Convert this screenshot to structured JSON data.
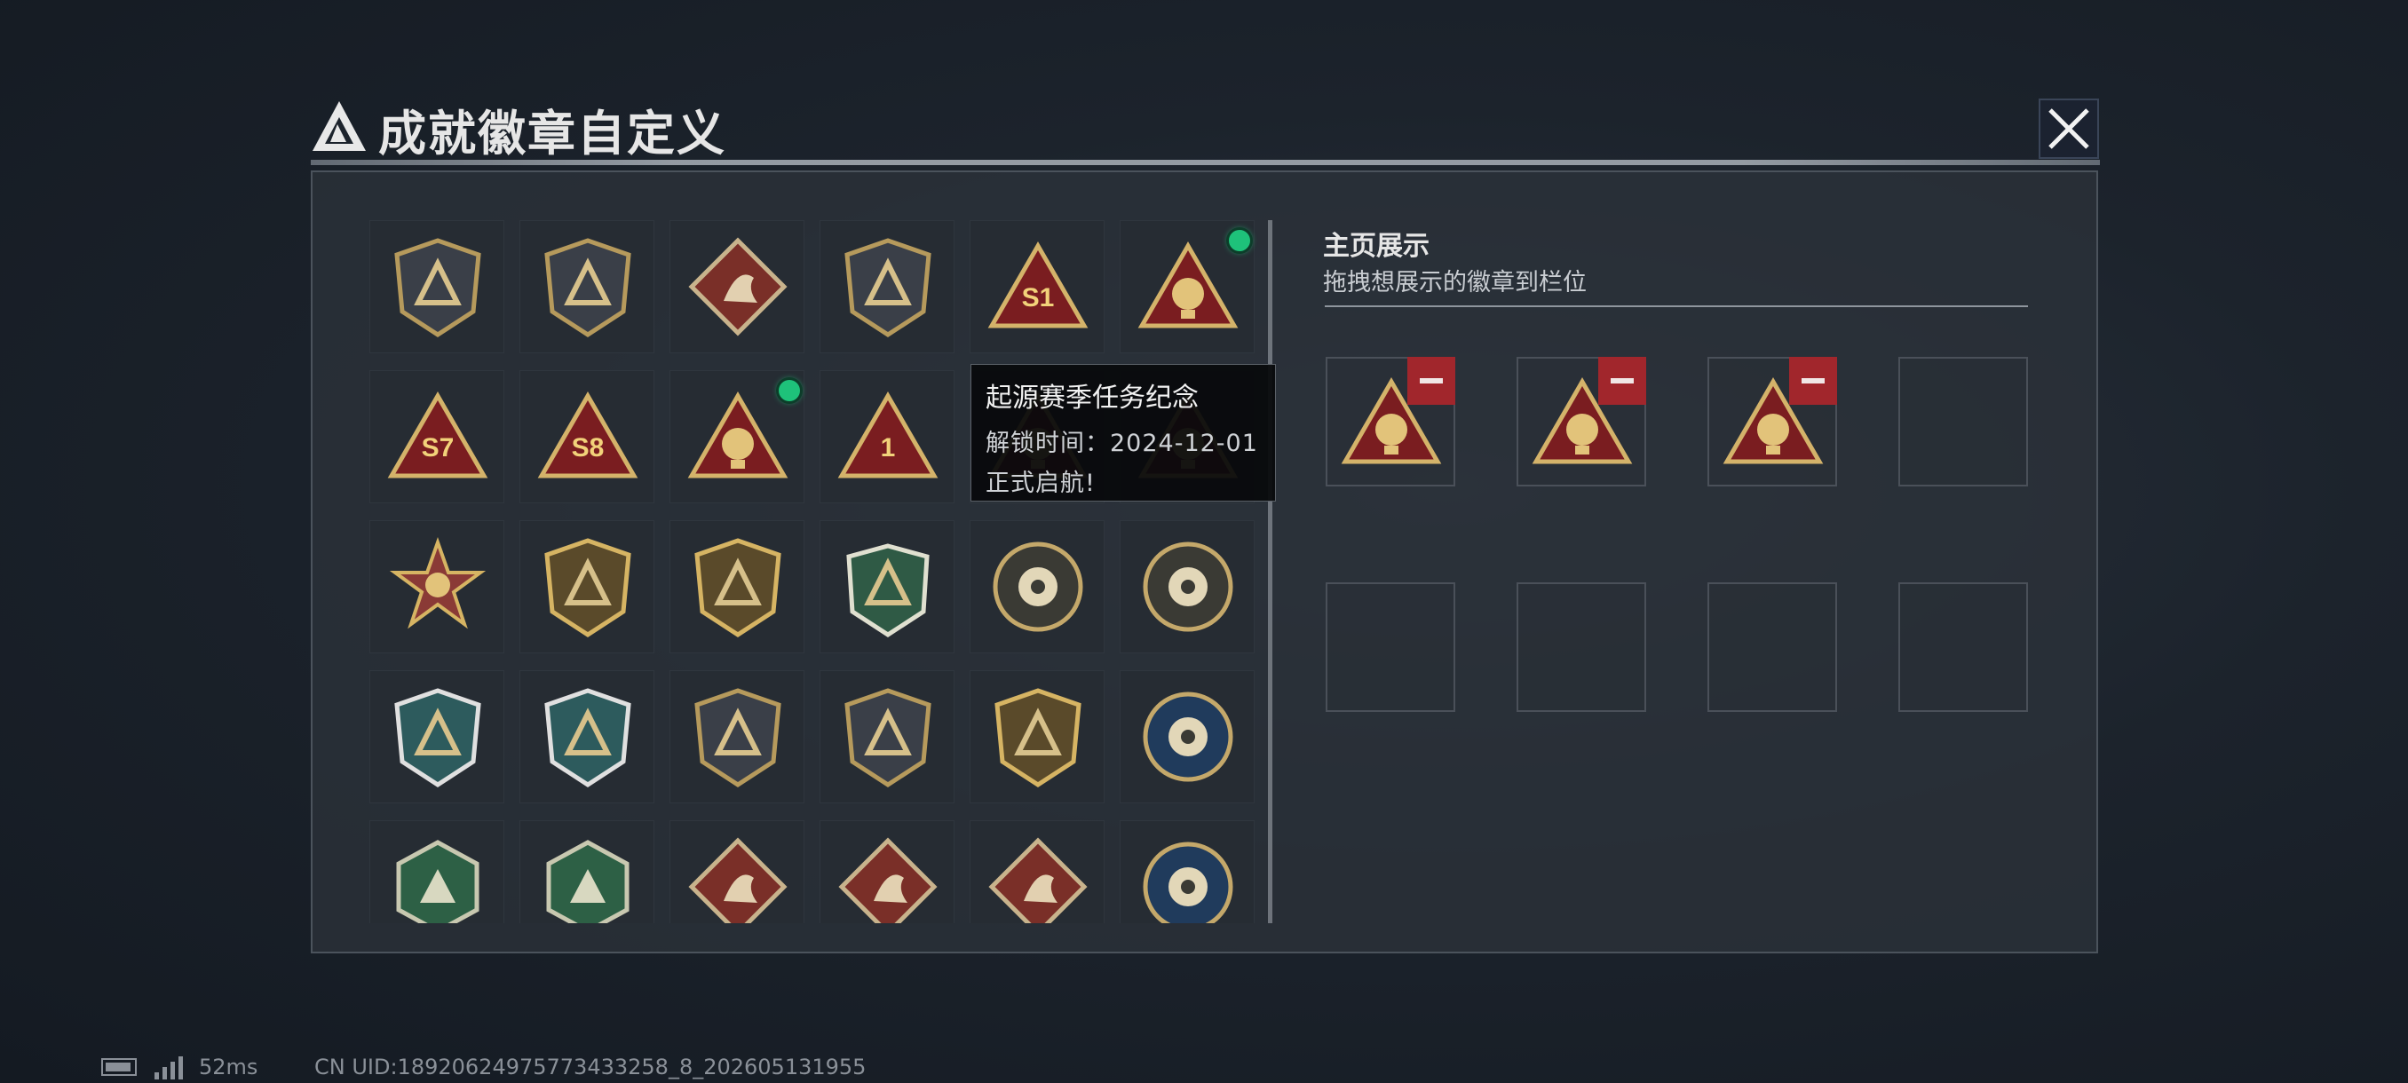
{
  "header": {
    "title": "成就徽章自定义"
  },
  "tooltip": {
    "title": "起源赛季任务纪念",
    "unlock_label": "解锁时间：",
    "unlock_date": "2024-12-01",
    "description": "正式启航!"
  },
  "showcase": {
    "title": "主页展示",
    "subtitle": "拖拽想展示的徽章到栏位"
  },
  "status": {
    "ping": "52ms",
    "uid": "CN UID:18920624975773433258_8_202605131955"
  },
  "badges": [
    {
      "name": "badge-delta-shield-icon",
      "selected": false
    },
    {
      "name": "badge-helicopter-shield-icon",
      "selected": false
    },
    {
      "name": "badge-diamond-shield-icon",
      "selected": false
    },
    {
      "name": "badge-dagger-shield-icon",
      "selected": false
    },
    {
      "name": "badge-s1-triangle-icon",
      "label": "S1",
      "selected": false
    },
    {
      "name": "badge-globe-triangle-icon",
      "selected": true
    },
    {
      "name": "badge-s7-triangle-icon",
      "label": "S7",
      "selected": false
    },
    {
      "name": "badge-s8-triangle-icon",
      "label": "S8",
      "selected": false
    },
    {
      "name": "badge-ship-triangle-icon",
      "selected": true
    },
    {
      "name": "badge-one-triangle-icon",
      "label": "1",
      "selected": false
    },
    {
      "name": "badge-rocket-triangle-icon",
      "selected": false
    },
    {
      "name": "badge-crowned-triangle-icon",
      "selected": false
    },
    {
      "name": "badge-star-medal-icon",
      "selected": false
    },
    {
      "name": "badge-gold-shield-icon",
      "selected": false
    },
    {
      "name": "badge-star-crest-icon",
      "selected": false
    },
    {
      "name": "badge-green-gem-shield-icon",
      "selected": false
    },
    {
      "name": "badge-round-sniper-icon",
      "selected": false
    },
    {
      "name": "badge-round-skull-icon",
      "selected": false
    },
    {
      "name": "badge-rifle-crest-blue-icon",
      "selected": false
    },
    {
      "name": "badge-rifle-crest-blue-2-icon",
      "selected": false
    },
    {
      "name": "badge-knife-shield-icon",
      "selected": false
    },
    {
      "name": "badge-pistol-shield-icon",
      "selected": false
    },
    {
      "name": "badge-gold-rifle-crest-icon",
      "selected": false
    },
    {
      "name": "badge-eagle-round-icon",
      "selected": false
    },
    {
      "name": "badge-hornet-hexagon-icon",
      "selected": false
    },
    {
      "name": "badge-hammer-hexagon-icon",
      "selected": false
    },
    {
      "name": "badge-dragon-diamond-icon",
      "selected": false
    },
    {
      "name": "badge-dragon-diamond-2-icon",
      "selected": false
    },
    {
      "name": "badge-runner-diamond-icon",
      "selected": false
    },
    {
      "name": "badge-wolf-round-icon",
      "selected": false
    }
  ],
  "slots": [
    {
      "badge": "badge-globe-triangle-icon",
      "filled": true
    },
    {
      "badge": "badge-ship-triangle-icon",
      "filled": true
    },
    {
      "badge": "badge-rocket-triangle-icon",
      "filled": true
    },
    {
      "filled": false
    },
    {
      "filled": false
    },
    {
      "filled": false
    },
    {
      "filled": false
    },
    {
      "filled": false
    }
  ]
}
